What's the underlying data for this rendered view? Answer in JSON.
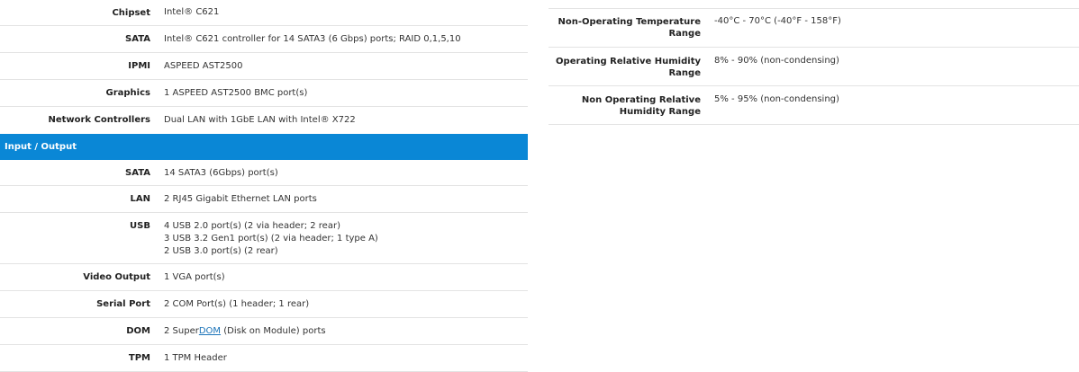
{
  "top_rows": [
    {
      "label": "Chipset",
      "value": "Intel® C621"
    },
    {
      "label": "SATA",
      "value": "Intel® C621 controller for 14 SATA3 (6 Gbps) ports; RAID 0,1,5,10"
    },
    {
      "label": "IPMI",
      "value": "ASPEED AST2500"
    },
    {
      "label": "Graphics",
      "value": "1 ASPEED AST2500 BMC port(s)"
    },
    {
      "label": "Network Controllers",
      "value": "Dual LAN with 1GbE LAN with Intel® X722"
    }
  ],
  "section_title": "Input / Output",
  "io_rows": [
    {
      "label": "SATA",
      "lines": [
        "14 SATA3 (6Gbps) port(s)"
      ]
    },
    {
      "label": "LAN",
      "lines": [
        "2 RJ45 Gigabit Ethernet LAN ports"
      ]
    },
    {
      "label": "USB",
      "lines": [
        "4 USB 2.0 port(s) (2 via header; 2 rear)",
        "3 USB 3.2 Gen1 port(s) (2 via header; 1 type A)",
        "2 USB 3.0 port(s) (2 rear)"
      ]
    },
    {
      "label": "Video Output",
      "lines": [
        "1 VGA port(s)"
      ]
    },
    {
      "label": "Serial Port",
      "lines": [
        "2 COM Port(s) (1 header; 1 rear)"
      ]
    },
    {
      "label": "DOM",
      "prefix": "2 Super",
      "link": "DOM",
      "suffix": " (Disk on Module) ports"
    },
    {
      "label": "TPM",
      "lines": [
        "1 TPM Header"
      ]
    }
  ],
  "env_rows": [
    {
      "label": "Non-Operating Temperature Range",
      "value": "-40°C - 70°C (-40°F - 158°F)"
    },
    {
      "label": "Operating Relative Humidity Range",
      "value": "8% - 90% (non-condensing)"
    },
    {
      "label": "Non Operating Relative Humidity Range",
      "value": "5% - 95% (non-condensing)"
    }
  ],
  "colors": {
    "section_bg": "#0a87d6",
    "link": "#1a73b8"
  }
}
